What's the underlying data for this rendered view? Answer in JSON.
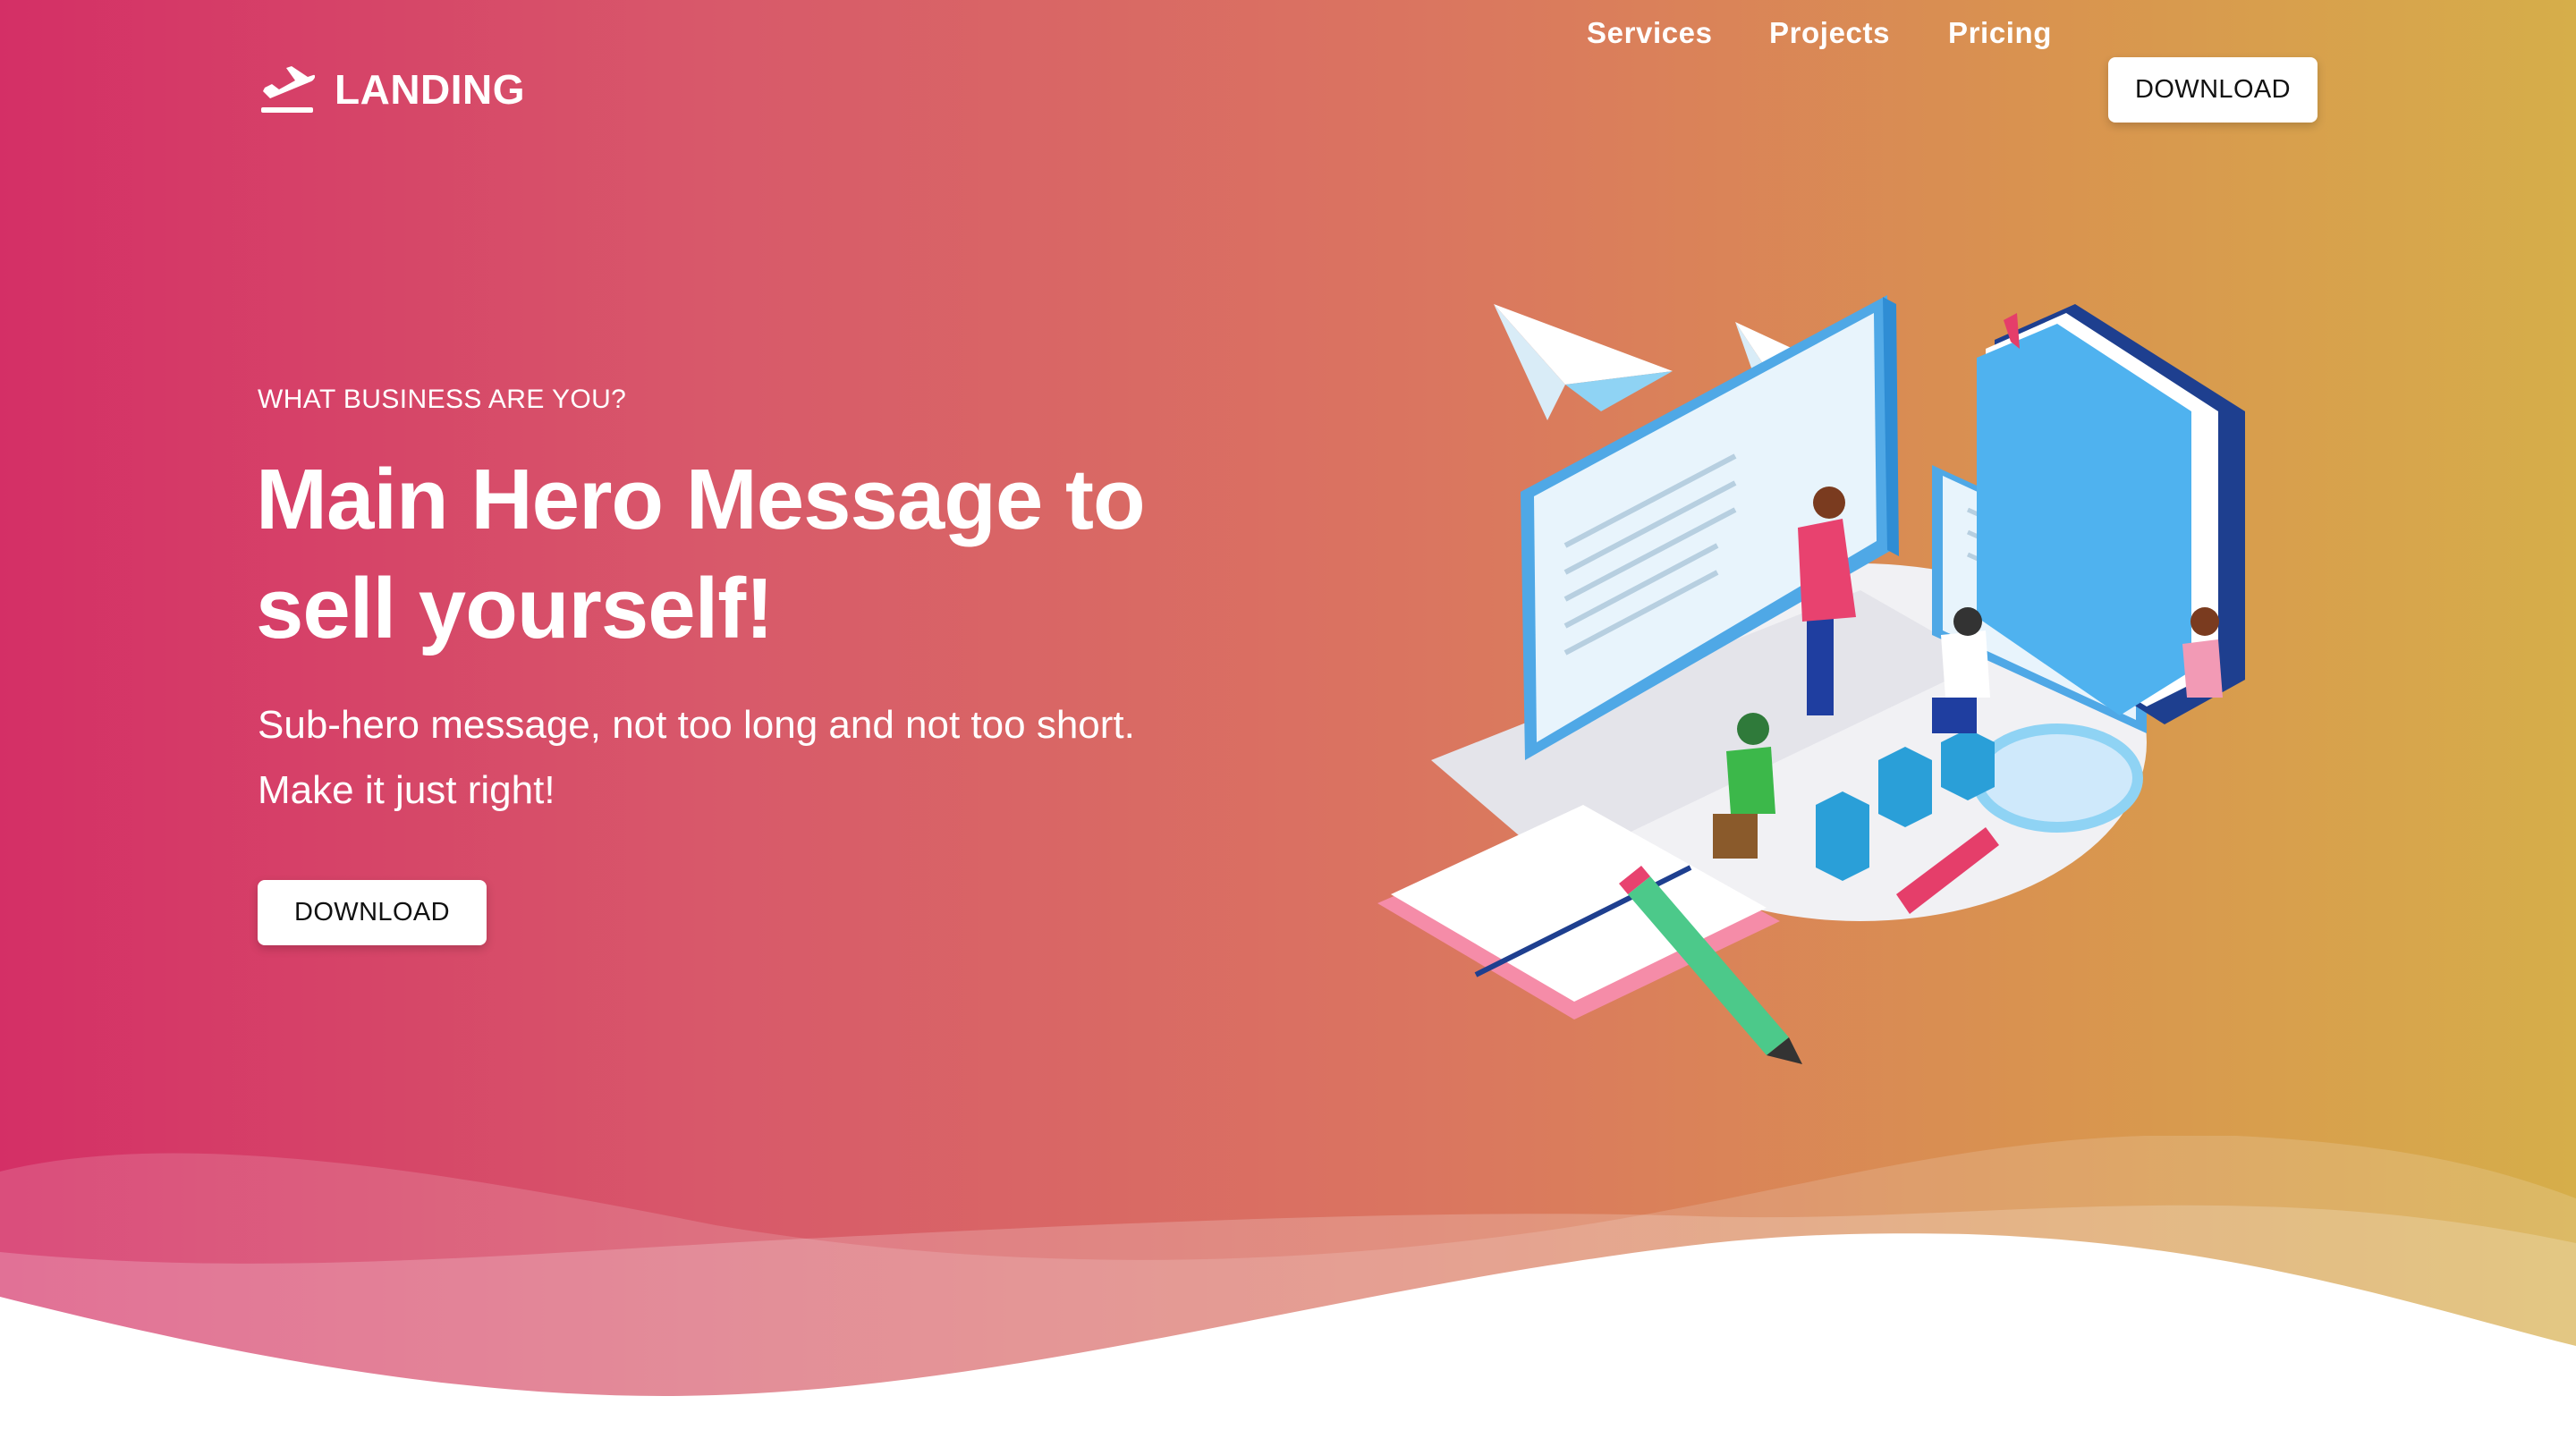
{
  "brand": {
    "name": "LANDING",
    "icon": "plane-takeoff-icon"
  },
  "nav": {
    "links": [
      "Services",
      "Projects",
      "Pricing"
    ],
    "download_label": "DOWNLOAD"
  },
  "hero": {
    "eyebrow": "WHAT BUSINESS ARE YOU?",
    "headline": "Main Hero Message to sell yourself!",
    "subline_1": "Sub-hero message, not too long and not too short.",
    "subline_2": "Make it just right!",
    "cta_label": "DOWNLOAD"
  },
  "colors": {
    "gradient_start": "#d42f66",
    "gradient_end": "#d6ae4a",
    "button_bg": "#ffffff",
    "button_text": "#111111"
  }
}
